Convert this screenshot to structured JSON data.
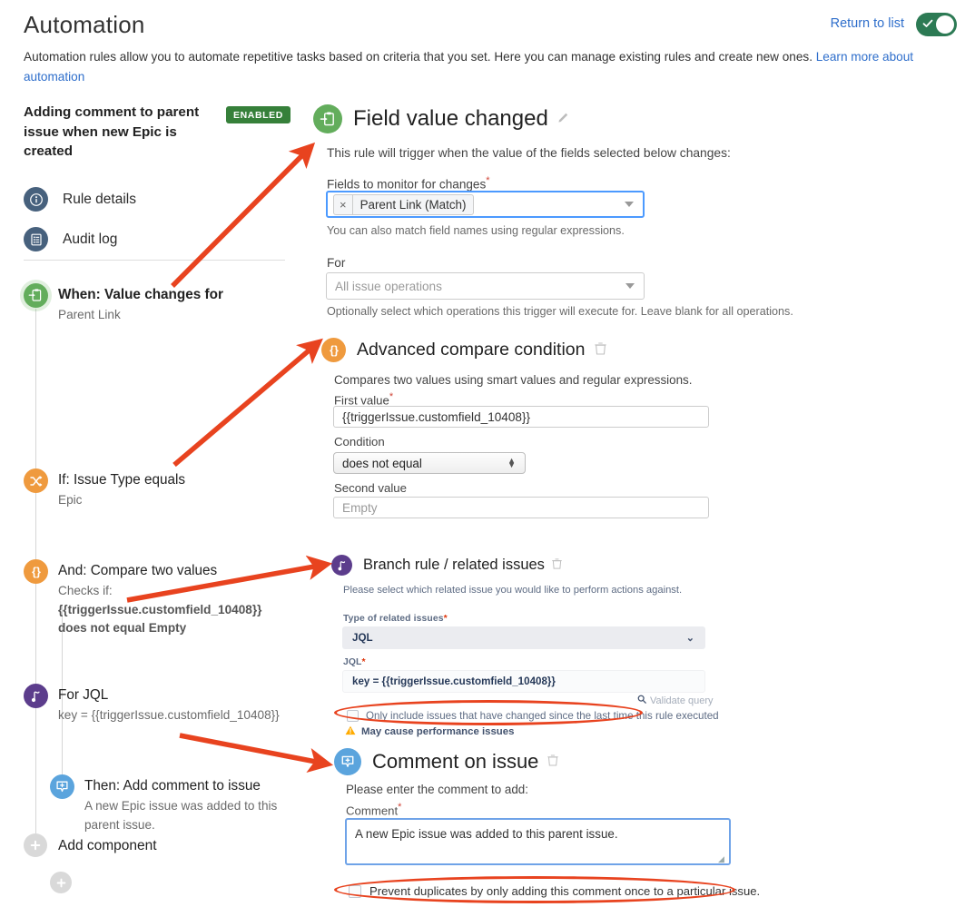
{
  "header": {
    "title": "Automation",
    "return_link": "Return to list",
    "toggle_state_icon": "check-icon",
    "intro_text": "Automation rules allow you to automate repetitive tasks based on criteria that you set. Here you can manage existing rules and create new ones. ",
    "intro_link": "Learn more about automation"
  },
  "sidebar": {
    "rule_name": "Adding comment to parent issue when new Epic is created",
    "status_badge": "ENABLED",
    "nav": [
      {
        "label": "Rule details",
        "icon": "info-circle-icon"
      },
      {
        "label": "Audit log",
        "icon": "list-document-icon"
      }
    ],
    "tree": [
      {
        "title": "When: Value changes for",
        "subtitle": "Parent Link",
        "icon": "trigger-clipboard-icon",
        "color": "green"
      },
      {
        "title": "If: Issue Type equals",
        "subtitle": "Epic",
        "icon": "shuffle-icon",
        "color": "orange"
      },
      {
        "title": "And: Compare two values",
        "subtitle": "Checks if:",
        "subtitle_bold_1": "{{triggerIssue.customfield_10408}}",
        "subtitle_bold_2": "does not equal Empty",
        "icon": "curly-braces-icon",
        "color": "orange"
      },
      {
        "title": "For JQL",
        "subtitle": "key = {{triggerIssue.customfield_10408}}",
        "icon": "branch-icon",
        "color": "purple"
      },
      {
        "title": "Then: Add comment to issue",
        "subtitle": "A new Epic issue was added to this parent issue.",
        "icon": "comment-add-icon",
        "color": "blue"
      }
    ],
    "add_child_label": "",
    "add_component_label": "Add component",
    "add_icon": "plus-icon"
  },
  "trigger_panel": {
    "title": "Field value changed",
    "icon": "trigger-clipboard-icon",
    "edit_icon": "pencil-icon",
    "description": "This rule will trigger when the value of the fields selected below changes:",
    "fields_label": "Fields to monitor for changes",
    "fields_required": "*",
    "selected_chip": "Parent Link (Match)",
    "chip_remove_icon": "close-icon",
    "dropdown_icon": "chevron-down-icon",
    "fields_hint": "You can also match field names using regular expressions.",
    "for_label": "For",
    "for_value": "All issue operations",
    "for_hint": "Optionally select which operations this trigger will execute for. Leave blank for all operations."
  },
  "condition_panel": {
    "title": "Advanced compare condition",
    "icon": "curly-braces-icon",
    "delete_icon": "trash-icon",
    "description": "Compares two values using smart values and regular expressions.",
    "first_value_label": "First value",
    "first_value_required": "*",
    "first_value": "{{triggerIssue.customfield_10408}}",
    "condition_label": "Condition",
    "condition_value": "does not equal",
    "second_value_label": "Second value",
    "second_value_placeholder": "Empty"
  },
  "branch_panel": {
    "title": "Branch rule / related issues",
    "icon": "branch-icon",
    "delete_icon": "trash-icon",
    "description": "Please select which related issue you would like to perform actions against.",
    "type_label": "Type of related issues",
    "type_required": "*",
    "type_value": "JQL",
    "dropdown_icon": "chevron-down-icon",
    "jql_label": "JQL",
    "jql_required": "*",
    "jql_value": "key = {{triggerIssue.customfield_10408}}",
    "validate_label": "Validate query",
    "validate_icon": "magnifier-icon",
    "only_changed_label": "Only include issues that have changed since the last time this rule executed",
    "only_changed_checked": false,
    "warning_label": "May cause performance issues",
    "warning_icon": "warning-triangle-icon"
  },
  "comment_panel": {
    "title": "Comment on issue",
    "icon": "comment-add-icon",
    "delete_icon": "trash-icon",
    "description": "Please enter the comment to add:",
    "comment_label": "Comment",
    "comment_required": "*",
    "comment_value": "A new Epic issue was added to this parent issue.",
    "prevent_duplicates_label": "Prevent duplicates by only adding this comment once to a particular issue.",
    "prevent_duplicates_checked": false
  },
  "annotations": {
    "highlight_color": "#e8431f",
    "arrows": 4,
    "ellipses": 2
  }
}
